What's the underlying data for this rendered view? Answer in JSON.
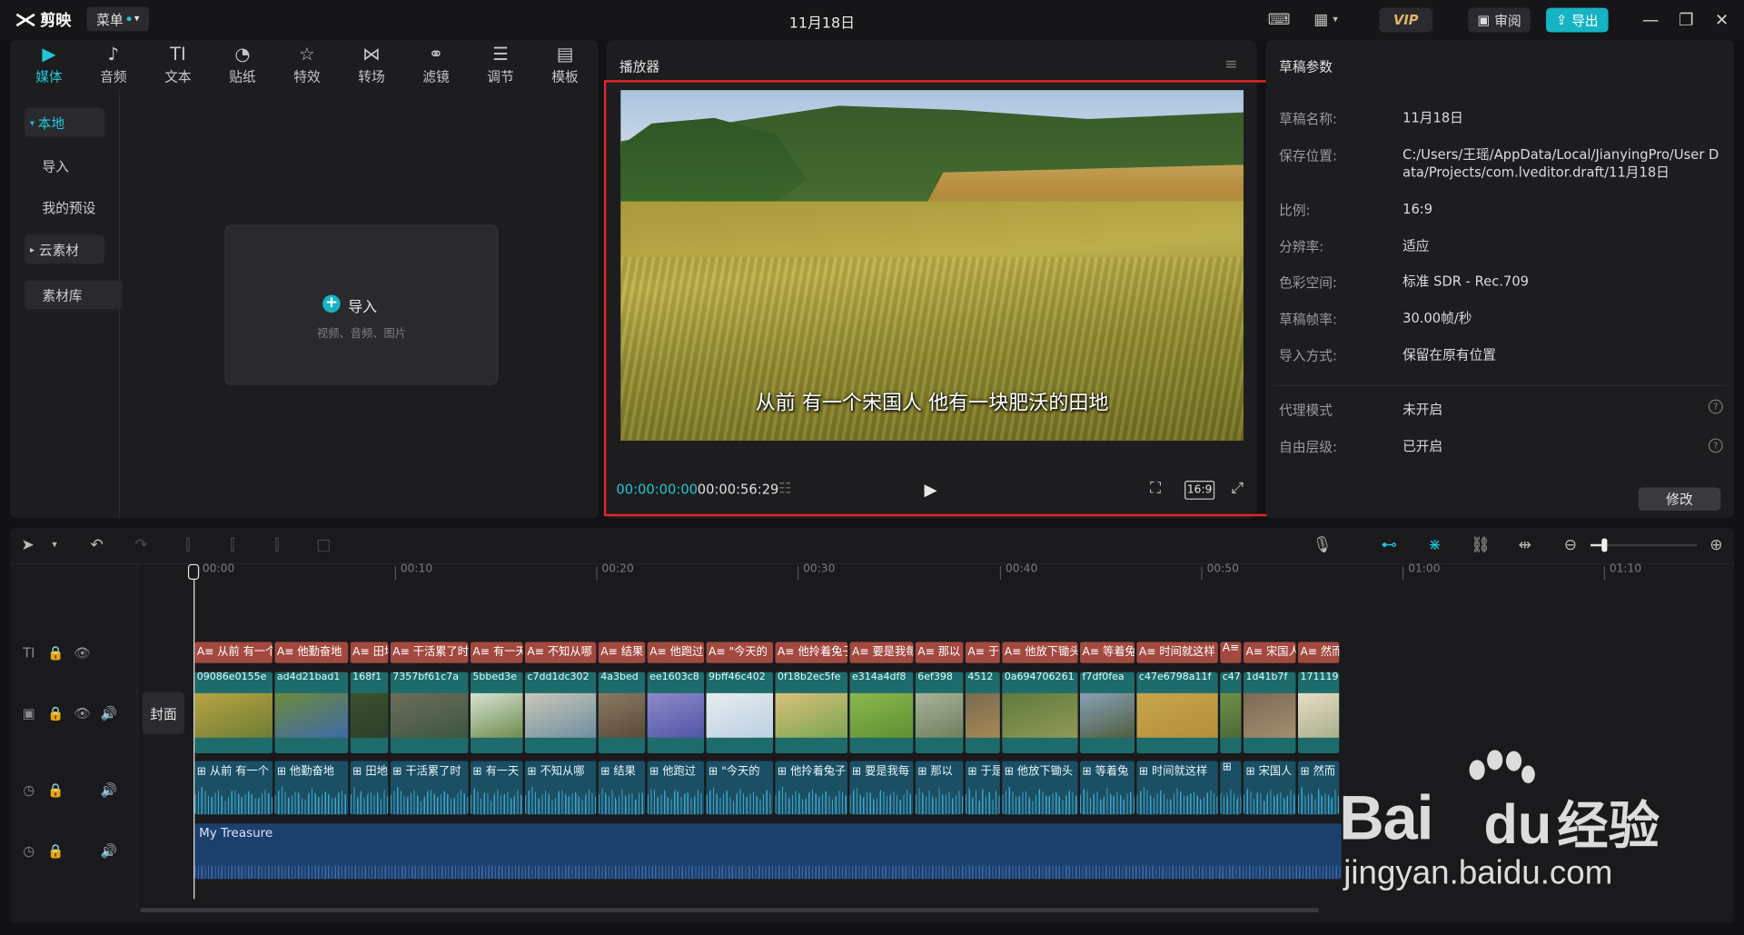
{
  "titlebar": {
    "app_name": "剪映",
    "menu_label": "菜单",
    "project_title": "11月18日",
    "vip_label": "VIP",
    "review_label": "审阅",
    "export_label": "导出"
  },
  "media_tabs": [
    {
      "label": "媒体",
      "icon": "media-icon",
      "active": true
    },
    {
      "label": "音频",
      "icon": "audio-icon"
    },
    {
      "label": "文本",
      "icon": "text-icon"
    },
    {
      "label": "贴纸",
      "icon": "sticker-icon"
    },
    {
      "label": "特效",
      "icon": "effects-icon"
    },
    {
      "label": "转场",
      "icon": "transition-icon"
    },
    {
      "label": "滤镜",
      "icon": "filter-icon"
    },
    {
      "label": "调节",
      "icon": "adjust-icon"
    },
    {
      "label": "模板",
      "icon": "template-icon"
    }
  ],
  "sidebar": {
    "local": "本地",
    "import": "导入",
    "my_presets": "我的预设",
    "cloud": "云素材",
    "library": "素材库"
  },
  "import_card": {
    "label": "导入",
    "hint": "视频、音频、图片"
  },
  "player": {
    "title": "播放器",
    "subtitle": "从前 有一个宋国人 他有一块肥沃的田地",
    "current_time": "00:00:00:00",
    "total_time": "00:00:56:29",
    "ratio_label": "16:9"
  },
  "draft": {
    "title": "草稿参数",
    "rows": [
      {
        "label": "草稿名称:",
        "value": "11月18日"
      },
      {
        "label": "保存位置:",
        "value": "C:/Users/王瑶/AppData/Local/JianyingPro/User Data/Projects/com.lveditor.draft/11月18日"
      },
      {
        "label": "比例:",
        "value": "16:9"
      },
      {
        "label": "分辨率:",
        "value": "适应"
      },
      {
        "label": "色彩空间:",
        "value": "标准 SDR - Rec.709"
      },
      {
        "label": "草稿帧率:",
        "value": "30.00帧/秒"
      },
      {
        "label": "导入方式:",
        "value": "保留在原有位置"
      }
    ],
    "rows2": [
      {
        "label": "代理模式",
        "value": "未开启"
      },
      {
        "label": "自由层级:",
        "value": "已开启"
      }
    ],
    "edit_label": "修改"
  },
  "timeline": {
    "ruler": [
      "00:00",
      "00:10",
      "00:20",
      "00:30",
      "00:40",
      "00:50",
      "01:00",
      "01:10"
    ],
    "cover_label": "封面",
    "text_clips": [
      "从前 有一个",
      "他勤奋地",
      "田地",
      "干活累了时",
      "有一天",
      "不知从哪",
      "结果",
      "他跑过",
      "\"今天的",
      "他拎着兔子",
      "要是我每",
      "那以",
      "于是",
      "他放下锄头",
      "等着兔",
      "时间就这样",
      "",
      "宋国人",
      "然而"
    ],
    "video_clips": [
      "09086e0155e",
      "ad4d21bad1",
      "168f1",
      "7357bf61c7a",
      "5bbed3e",
      "c7dd1dc302",
      "4a3bed",
      "ee1603c8",
      "9bff46c402",
      "0f18b2ec5fe",
      "e314a4df8",
      "6ef398",
      "4512",
      "0a694706261",
      "f7df0fea",
      "c47e6798a11f",
      "c47",
      "1d41b7f",
      "171119"
    ],
    "audio_clips": [
      "从前 有一个",
      "他勤奋地",
      "田地",
      "干活累了时",
      "有一天",
      "不知从哪",
      "结果",
      "他跑过",
      "\"今天的",
      "他拎着兔子",
      "要是我每",
      "那以",
      "于是",
      "他放下锄头",
      "等着兔",
      "时间就这样",
      "",
      "宋国人",
      "然而"
    ],
    "music_label": "My Treasure"
  },
  "watermark": {
    "brand": "Bai",
    "brand_cn": "经验",
    "url": "jingyan.baidu.com"
  },
  "colors": {
    "accent": "#22c7d6",
    "highlight_frame": "#e2262a",
    "text_clip": "#a3493f",
    "video_clip": "#1e6b6c",
    "audio_clip": "#1b4f63",
    "music_clip": "#1c3f6c"
  }
}
